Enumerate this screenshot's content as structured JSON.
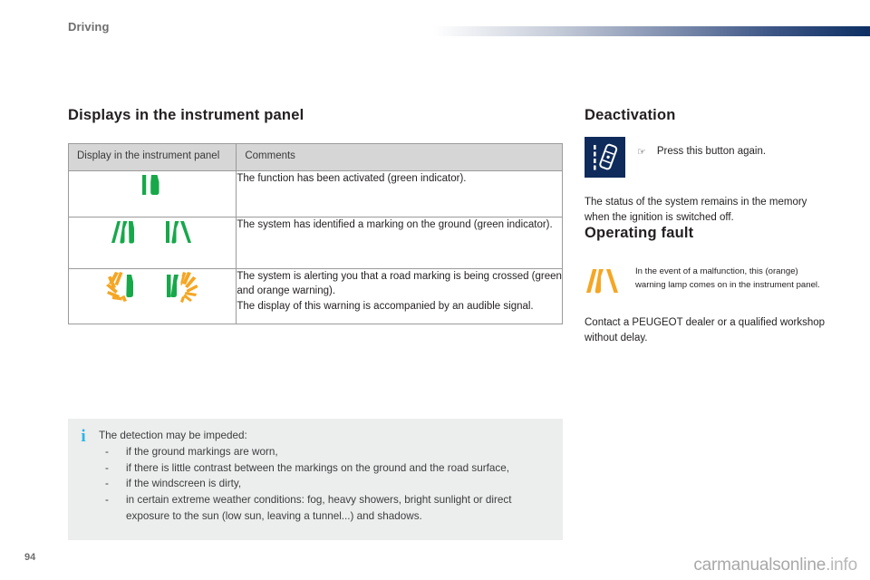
{
  "header": {
    "section": "Driving",
    "rule_gradient_from": "#ffffff",
    "rule_gradient_to": "#0d2f63"
  },
  "left": {
    "heading": "Displays in the instrument panel",
    "table": {
      "columns": [
        "Display in the instrument panel",
        "Comments"
      ],
      "rows": [
        {
          "icon": "lane-assist-green-single-icon",
          "comment": "The function has been activated (green indicator)."
        },
        {
          "icon": "lane-marking-detected-green-pair-icon",
          "comment": "The system has identified a marking on the ground (green indicator)."
        },
        {
          "icon": "lane-crossing-warning-orange-green-pair-icon",
          "comment_line1": "The system is alerting you that a road marking is being crossed (green and orange warning).",
          "comment_line2": "The display of this warning is accompanied by an audible signal."
        }
      ]
    },
    "info_box": {
      "icon": "information-icon",
      "icon_glyph": "i",
      "lead": "The detection may be impeded:",
      "dash": "-",
      "items": [
        "if the ground markings are worn,",
        "if there is little contrast between the markings on the ground and the road surface,",
        "if the windscreen is dirty,",
        "in certain extreme weather conditions: fog, heavy showers, bright sunlight or direct exposure to the sun (low sun, leaving a tunnel...) and shadows."
      ]
    }
  },
  "right": {
    "deactivation": {
      "heading": "Deactivation",
      "button_icon": "lane-departure-warning-button-icon",
      "bullet_glyph": "☞",
      "bullet_text": "Press this button again.",
      "note": "The status of the system remains in the memory when the ignition is switched off."
    },
    "operating_fault": {
      "heading": "Operating fault",
      "warning_icon": "lane-departure-fault-orange-icon",
      "warning_text": "In the event of a malfunction, this (orange) warning lamp comes on in the instrument panel.",
      "action_text": "Contact a PEUGEOT dealer or a qualified workshop without delay."
    }
  },
  "footer": {
    "page_number": "94",
    "watermark_main": "carmanualsonline",
    "watermark_suffix": ".info"
  },
  "colors": {
    "green": "#17a84a",
    "orange": "#f5a623",
    "navy": "#0f2b5b",
    "info_blue": "#29b6e8",
    "header_grey": "#6e6e70",
    "table_header_bg": "#d6d6d6",
    "info_box_bg": "#eceded"
  }
}
